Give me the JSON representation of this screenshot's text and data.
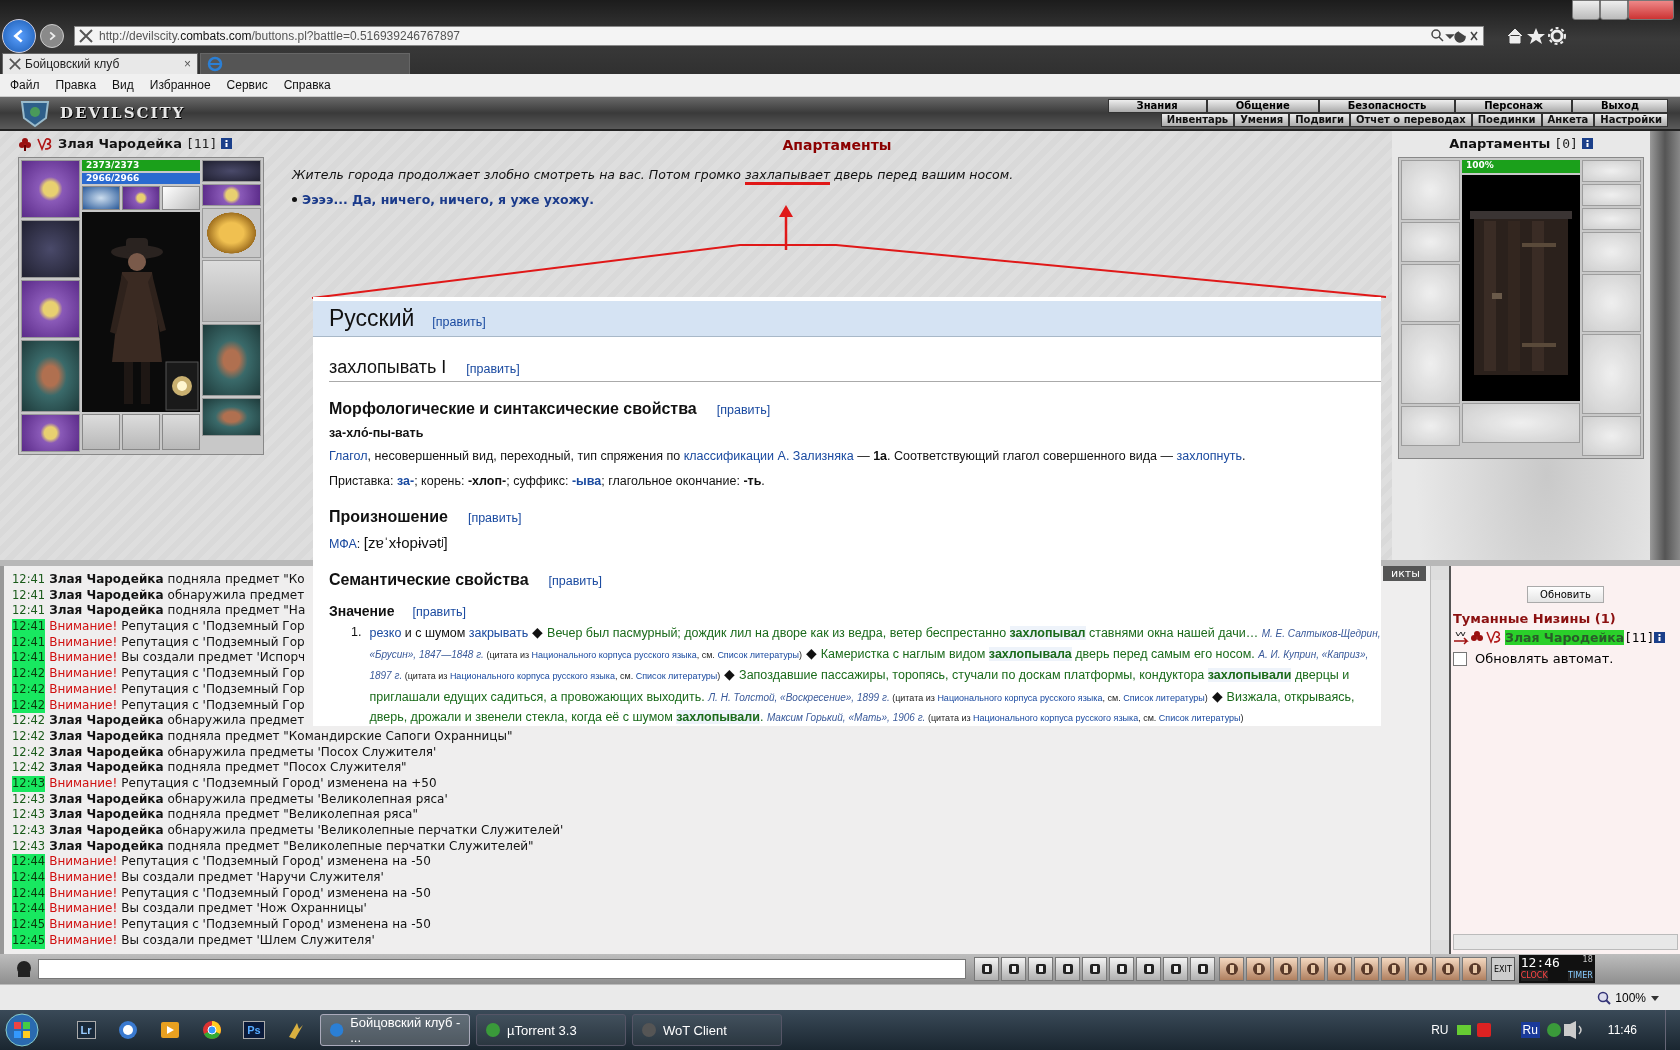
{
  "browser": {
    "url_prefix": "http://devilscity.",
    "url_domain": "combats.com",
    "url_suffix": "/buttons.pl?battle=0.516939246767897",
    "tabs": [
      {
        "label": "Бойцовский клуб",
        "close": "×",
        "selected": true
      }
    ],
    "menu": [
      "Файл",
      "Правка",
      "Вид",
      "Избранное",
      "Сервис",
      "Справка"
    ]
  },
  "game": {
    "logo": "DEVILSCITY",
    "nav_top": [
      "Знания",
      "Общение",
      "Безопасность",
      "Персонаж",
      "Выход"
    ],
    "nav_bottom": [
      "Инвентарь",
      "Умения",
      "Подвиги",
      "Отчет о переводах",
      "Поединки",
      "Анкета",
      "Настройки"
    ]
  },
  "player": {
    "name": "Злая Чародейка",
    "level": "[11]",
    "hp": {
      "reading": "2373/2373",
      "level": 1
    },
    "mana": {
      "reading": "2966/2966",
      "level": 1
    }
  },
  "scene": {
    "title": "Апартаменты",
    "text_before": "Житель города продолжает злобно смотреть на вас. Потом громко ",
    "highlight": "захлапывает",
    "text_after": " дверь перед вашим носом.",
    "options": [
      "Ээээ... Да, ничего, ничего, я уже ухожу."
    ]
  },
  "opponent": {
    "name": "Апартаменты",
    "level": "[0]",
    "health": {
      "reading": "100%",
      "level": 1
    }
  },
  "wiki": {
    "blocks": [
      {
        "kind": "lang",
        "text": "Русский",
        "edit": "[править]"
      },
      {
        "kind": "h2",
        "text": "захлопывать I",
        "edit": "[править]"
      },
      {
        "kind": "h3",
        "text": "Морфологические и синтаксические свойства",
        "edit": "[править]"
      },
      {
        "kind": "syllables",
        "text": "за-хло́-пы-вать"
      },
      {
        "kind": "para",
        "segments": [
          {
            "kind": "link",
            "t": "Глагол"
          },
          {
            "kind": "plain",
            "t": ", несовершенный вид, переходный, тип спряжения по "
          },
          {
            "kind": "link",
            "t": "классификации А. Зализняка"
          },
          {
            "kind": "plain",
            "t": " — "
          },
          {
            "kind": "bold",
            "t": "1a"
          },
          {
            "kind": "plain",
            "t": ". Соответствующий глагол совершенного вида — "
          },
          {
            "kind": "link",
            "t": "захлопнуть"
          },
          {
            "kind": "plain",
            "t": "."
          }
        ]
      },
      {
        "kind": "para",
        "segments": [
          {
            "kind": "plain",
            "t": "Приставка: "
          },
          {
            "kind": "linkbold",
            "t": "за-"
          },
          {
            "kind": "plain",
            "t": "; корень: "
          },
          {
            "kind": "bold",
            "t": "-хлоп-"
          },
          {
            "kind": "plain",
            "t": "; суффикс: "
          },
          {
            "kind": "linkbold",
            "t": "-ыва"
          },
          {
            "kind": "plain",
            "t": "; глагольное окончание: "
          },
          {
            "kind": "bold",
            "t": "-ть"
          },
          {
            "kind": "plain",
            "t": "."
          }
        ]
      },
      {
        "kind": "h3",
        "text": "Произношение",
        "edit": "[править]"
      },
      {
        "kind": "para",
        "segments": [
          {
            "kind": "link",
            "t": "МФА"
          },
          {
            "kind": "plain",
            "t": ": "
          },
          {
            "kind": "ipa",
            "t": "[zɐˈxɫopɨvətʲ]"
          }
        ]
      },
      {
        "kind": "h3",
        "text": "Семантические свойства",
        "edit": "[править]"
      },
      {
        "kind": "h4",
        "text": "Значение",
        "edit": "[править]"
      },
      {
        "kind": "item",
        "number": "1.",
        "segments": [
          {
            "kind": "link",
            "t": "резко"
          },
          {
            "kind": "plain",
            "t": " и с шумом "
          },
          {
            "kind": "link",
            "t": "закрывать"
          },
          {
            "kind": "mark",
            "t": " ◆ "
          },
          {
            "kind": "green",
            "t": "Вечер был пасмурный; дождик лил на дворе как из ведра, ветер беспрестанно "
          },
          {
            "kind": "greenbold",
            "t": "захлопывал"
          },
          {
            "kind": "green",
            "t": " ставнями окна нашей дачи… "
          },
          {
            "kind": "cite",
            "t": "М. Е. Салтыков-Щедрин, «Брусин», 1847—1848 г."
          },
          {
            "kind": "small",
            "t": " (цитата из "
          },
          {
            "kind": "smalllink",
            "t": "Национального корпуса русского языка"
          },
          {
            "kind": "small",
            "t": ", см. "
          },
          {
            "kind": "smalllink",
            "t": "Список литературы"
          },
          {
            "kind": "small",
            "t": ")"
          },
          {
            "kind": "mark",
            "t": " ◆ "
          },
          {
            "kind": "green",
            "t": "Камеристка с наглым видом "
          },
          {
            "kind": "greenbold",
            "t": "захлопывала"
          },
          {
            "kind": "green",
            "t": " дверь перед самым его носом. "
          },
          {
            "kind": "cite",
            "t": "А. И. Куприн, «Каприз», 1897 г."
          },
          {
            "kind": "small",
            "t": " (цитата из "
          },
          {
            "kind": "smalllink",
            "t": "Национального корпуса русского языка"
          },
          {
            "kind": "small",
            "t": ", см. "
          },
          {
            "kind": "smalllink",
            "t": "Список литературы"
          },
          {
            "kind": "small",
            "t": ")"
          },
          {
            "kind": "mark",
            "t": " ◆ "
          },
          {
            "kind": "green",
            "t": "Запоздавшие пассажиры, торопясь, стучали по доскам платформы, кондуктора "
          },
          {
            "kind": "greenbold",
            "t": "захлопывали"
          },
          {
            "kind": "green",
            "t": " дверцы и приглашали едущих садиться, а провожающих выходить. "
          },
          {
            "kind": "cite",
            "t": "Л. Н. Толстой, «Воскресение», 1899 г."
          },
          {
            "kind": "small",
            "t": " (цитата из "
          },
          {
            "kind": "smalllink",
            "t": "Национального корпуса русского языка"
          },
          {
            "kind": "small",
            "t": ", см. "
          },
          {
            "kind": "smalllink",
            "t": "Список литературы"
          },
          {
            "kind": "small",
            "t": ")"
          },
          {
            "kind": "mark",
            "t": " ◆ "
          },
          {
            "kind": "green",
            "t": "Визжала, открываясь, дверь, дрожали и звенели стекла, когда её с шумом "
          },
          {
            "kind": "greenbold",
            "t": "захлопывали"
          },
          {
            "kind": "green",
            "t": ". "
          },
          {
            "kind": "cite",
            "t": "Максим Горький, «Мать», 1906 г."
          },
          {
            "kind": "small",
            "t": " (цитата из "
          },
          {
            "kind": "smalllink",
            "t": "Национального корпуса русского языка"
          },
          {
            "kind": "small",
            "t": ", см. "
          },
          {
            "kind": "smalllink",
            "t": "Список литературы"
          },
          {
            "kind": "small",
            "t": ")"
          }
        ]
      }
    ]
  },
  "chat": {
    "tab": "икты",
    "lines": [
      {
        "time": "12:41",
        "kind": "action",
        "actor": "Злая Чародейка",
        "text": "подняла предмет \"Ко"
      },
      {
        "time": "12:41",
        "kind": "action",
        "actor": "Злая Чародейка",
        "text": "обнаружила предмет"
      },
      {
        "time": "12:41",
        "kind": "action",
        "actor": "Злая Чародейка",
        "text": "подняла предмет \"На"
      },
      {
        "time": "12:41",
        "kind": "system",
        "actor": "Внимание!",
        "text": "Репутация с 'Подземный Гор"
      },
      {
        "time": "12:41",
        "kind": "system",
        "actor": "Внимание!",
        "text": "Репутация с 'Подземный Гор"
      },
      {
        "time": "12:41",
        "kind": "system",
        "actor": "Внимание!",
        "text": "Вы создали предмет 'Испорч"
      },
      {
        "time": "12:42",
        "kind": "system",
        "actor": "Внимание!",
        "text": "Репутация с 'Подземный Гор"
      },
      {
        "time": "12:42",
        "kind": "system",
        "actor": "Внимание!",
        "text": "Репутация с 'Подземный Гор"
      },
      {
        "time": "12:42",
        "kind": "system",
        "actor": "Внимание!",
        "text": "Репутация с 'Подземный Гор"
      },
      {
        "time": "12:42",
        "kind": "action",
        "actor": "Злая Чародейка",
        "text": "обнаружила предмет"
      },
      {
        "time": "12:42",
        "kind": "action",
        "actor": "Злая Чародейка",
        "text": "подняла предмет \"Командирские Сапоги Охранницы\""
      },
      {
        "time": "12:42",
        "kind": "action",
        "actor": "Злая Чародейка",
        "text": "обнаружила предметы 'Посох Служителя'"
      },
      {
        "time": "12:42",
        "kind": "action",
        "actor": "Злая Чародейка",
        "text": "подняла предмет \"Посох Служителя\""
      },
      {
        "time": "12:43",
        "kind": "system",
        "actor": "Внимание!",
        "text": "Репутация с 'Подземный Город' изменена на +50"
      },
      {
        "time": "12:43",
        "kind": "action",
        "actor": "Злая Чародейка",
        "text": "обнаружила предметы 'Великолепная ряса'"
      },
      {
        "time": "12:43",
        "kind": "action",
        "actor": "Злая Чародейка",
        "text": "подняла предмет \"Великолепная ряса\""
      },
      {
        "time": "12:43",
        "kind": "action",
        "actor": "Злая Чародейка",
        "text": "обнаружила предметы 'Великолепные перчатки Служителей'"
      },
      {
        "time": "12:43",
        "kind": "action",
        "actor": "Злая Чародейка",
        "text": "подняла предмет \"Великолепные перчатки Служителей\""
      },
      {
        "time": "12:44",
        "kind": "system",
        "actor": "Внимание!",
        "text": "Репутация с 'Подземный Город' изменена на -50"
      },
      {
        "time": "12:44",
        "kind": "system",
        "actor": "Внимание!",
        "text": "Вы создали предмет 'Наручи Служителя'"
      },
      {
        "time": "12:44",
        "kind": "system",
        "actor": "Внимание!",
        "text": "Репутация с 'Подземный Город' изменена на -50"
      },
      {
        "time": "12:44",
        "kind": "system",
        "actor": "Внимание!",
        "text": "Вы создали предмет 'Нож Охранницы'"
      },
      {
        "time": "12:45",
        "kind": "system",
        "actor": "Внимание!",
        "text": "Репутация с 'Подземный Город' изменена на -50"
      },
      {
        "time": "12:45",
        "kind": "system",
        "actor": "Внимание!",
        "text": "Вы создали предмет 'Шлем Служителя'"
      }
    ]
  },
  "location": {
    "refresh": "Обновить",
    "title": "Туманные Низины (1)",
    "members": [
      {
        "name": "Злая Чародейка",
        "level": "[11]",
        "selected": true
      }
    ],
    "auto_refresh": {
      "label": "Обновлять автомат.",
      "checked": false
    }
  },
  "toolbar": {
    "exit": "EXIT",
    "clock": "12:46",
    "seconds": "18",
    "clock_label": "CLOCK",
    "timer_label": "TIMER"
  },
  "status_bar": {
    "zoom": "100%"
  },
  "taskbar": {
    "pinned": [
      {
        "kind": "lr",
        "label": "Lr"
      },
      {
        "kind": "ps",
        "label": "Ps"
      }
    ],
    "tasks": [
      {
        "label": "Бойцовский клуб - ...",
        "selected": true
      },
      {
        "label": "µTorrent 3.3",
        "selected": false
      },
      {
        "label": "WoT Client",
        "selected": false
      }
    ],
    "language": "RU",
    "tray_lang": "Ru",
    "time": "11:46"
  }
}
